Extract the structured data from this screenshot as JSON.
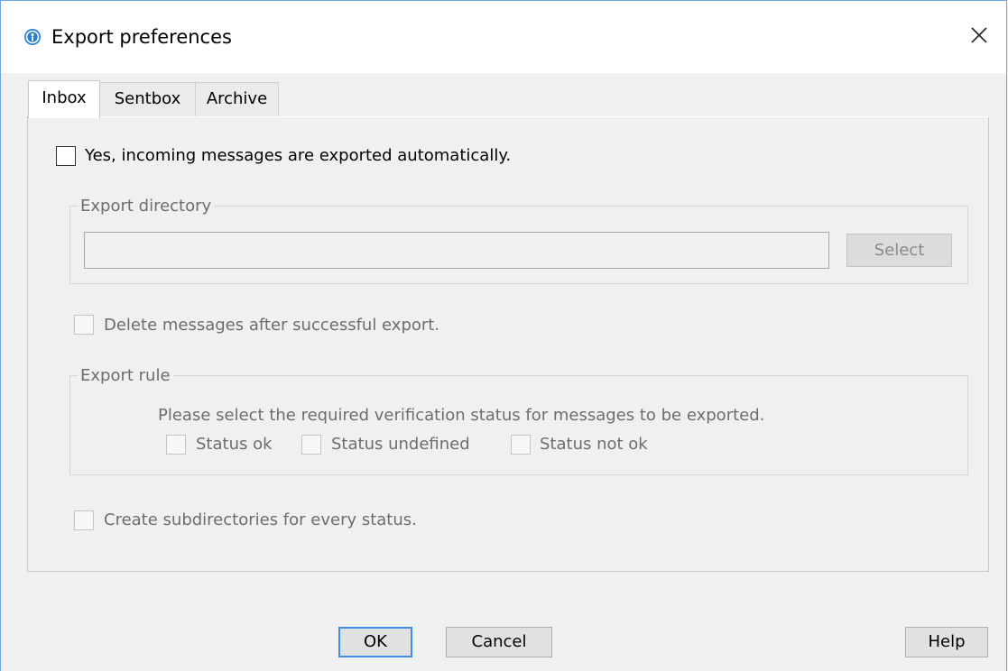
{
  "window": {
    "title": "Export preferences",
    "icon": "app-logo-icon",
    "close_icon": "close-icon"
  },
  "tabs": [
    {
      "label": "Inbox",
      "active": true
    },
    {
      "label": "Sentbox",
      "active": false
    },
    {
      "label": "Archive",
      "active": false
    }
  ],
  "inbox": {
    "auto_export_label": "Yes, incoming messages are exported automatically.",
    "auto_export_checked": false,
    "export_directory": {
      "title": "Export directory",
      "value": "",
      "select_label": "Select"
    },
    "delete_label": "Delete messages after successful export.",
    "export_rule": {
      "title": "Export rule",
      "description": "Please select the required verification status for messages to be exported.",
      "options": [
        {
          "label": "Status ok",
          "checked": false
        },
        {
          "label": "Status undefined",
          "checked": false
        },
        {
          "label": "Status not ok",
          "checked": false
        }
      ]
    },
    "subdirectories_label": "Create subdirectories for every status."
  },
  "buttons": {
    "ok": "OK",
    "cancel": "Cancel",
    "help": "Help"
  },
  "colors": {
    "accent": "#3c8ee5",
    "disabled_text": "#6d6d6d",
    "window_bg": "#f0f0f0"
  }
}
